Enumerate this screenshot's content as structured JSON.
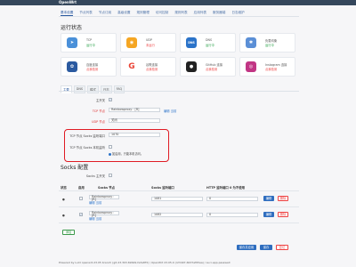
{
  "header": {
    "brand": "OpenWrt",
    "extra": ""
  },
  "tabs": [
    "基本设置",
    "节点列表",
    "节点订阅",
    "高级设置",
    "规则管理",
    "访问控制",
    "规则列表",
    "应用列表",
    "服务器端",
    "日志维护"
  ],
  "running_status": {
    "title": "运行状态",
    "cards": [
      {
        "name": "TCP",
        "status": "运行中",
        "state": "ok",
        "icon": "paper-plane-icon",
        "color": "#4a90d9"
      },
      {
        "name": "UDP",
        "status": "未运行",
        "state": "bad",
        "icon": "gamepad-icon",
        "color": "#f5a623"
      },
      {
        "name": "DNS",
        "status": "运行中",
        "state": "ok",
        "icon": "dns-icon",
        "color": "#2b73c9"
      },
      {
        "name": "负载均衡",
        "status": "运行中",
        "state": "ok",
        "icon": "network-icon",
        "color": "#5b8fd6"
      },
      {
        "name": "百度连接",
        "status": "点我检测",
        "state": "bad",
        "icon": "baidu-paw-icon",
        "color": "#2b5aa0"
      },
      {
        "name": "谷歌连接",
        "status": "点我检测",
        "state": "bad",
        "icon": "google-icon",
        "color": "#ea4335"
      },
      {
        "name": "GitHub 连接",
        "status": "点我检测",
        "state": "bad",
        "icon": "github-icon",
        "color": "#222222"
      },
      {
        "name": "Instagram 连接",
        "status": "点我检测",
        "state": "bad",
        "icon": "instagram-icon",
        "color": "#c13584"
      }
    ]
  },
  "subtabs": [
    "主要",
    "DNS",
    "模式",
    "日志",
    "FAQ"
  ],
  "main": {
    "master_switch": "主开关",
    "tcp_node_label": "TCP 节点",
    "tcp_node_value": "Rainbowproxy：[R]",
    "edit_link": "编辑 当前",
    "udp_node_label": "UDP 节点",
    "udp_node_value": "关闭",
    "socks_port_label": "TCP 节点 Socks 监听端口",
    "socks_port_value": "1070",
    "socks_remote_label": "TCP 节点 Socks 本机监听",
    "socks_remote_hint": "如启用，只能本机访问。"
  },
  "socks": {
    "title": "Socks 配置",
    "master_switch": "Socks 主开关",
    "headers": [
      "状态",
      "启用",
      "Socks 节点",
      "Socks 监听端口",
      "HTTP 监听端口 0 为不使用"
    ],
    "rows": [
      {
        "node": "Rainbowproxy：[R]",
        "edit": "编辑 当前",
        "socks_port": "1081",
        "http_port": "0",
        "enabled": ""
      },
      {
        "node": "Rainbowproxy：[R]",
        "edit": "编辑 当前",
        "socks_port": "1082",
        "http_port": "0",
        "enabled": "✓"
      }
    ],
    "edit_btn": "编辑",
    "delete_btn": "删除",
    "add_btn": "添加"
  },
  "actions": {
    "save_apply": "保存并应用",
    "save": "保存",
    "reset": "复位"
  },
  "footer": "Powered by LuCI openwrt-23.05 branch (git-23.303.69649-fe3a8f3) / OpenWrt 23.05.0 (r23497-6637af95aa) / Luci-app-passwall"
}
